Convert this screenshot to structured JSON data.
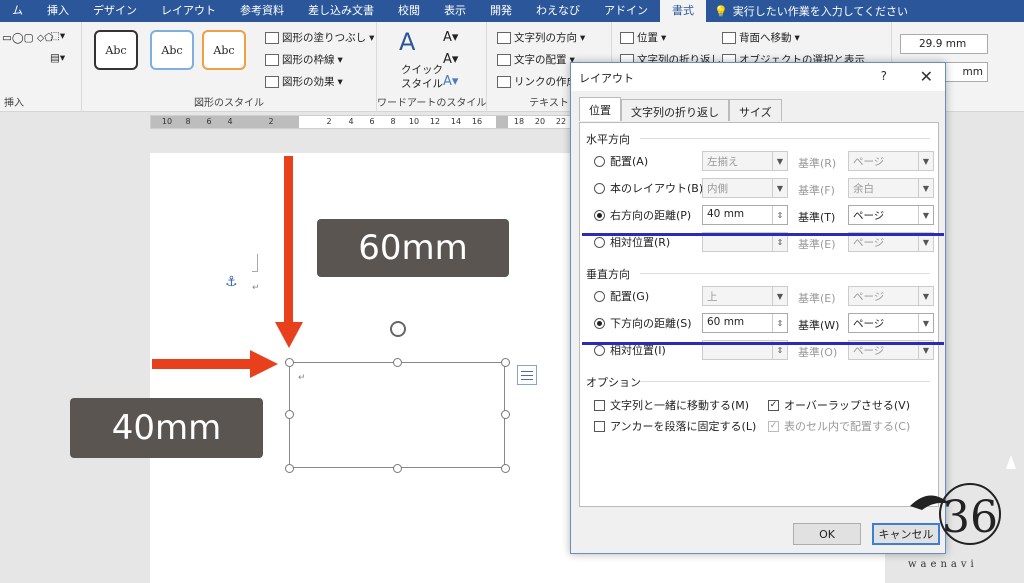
{
  "tabs": [
    "ム",
    "挿入",
    "デザイン",
    "レイアウト",
    "参考資料",
    "差し込み文書",
    "校閲",
    "表示",
    "開発",
    "わえなび",
    "アドイン",
    "書式"
  ],
  "tell_me": "実行したい作業を入力してください",
  "ribbon": {
    "insert_group_label": "挿入",
    "shape_styles_label": "図形のスタイル",
    "style_sample": "Abc",
    "fill": "図形の塗りつぶし",
    "outline": "図形の枠線",
    "effect": "図形の効果",
    "quick_style": "クイック",
    "quick_style2": "スタイル",
    "wordart_label": "ワードアートのスタイル",
    "text_dir": "文字列の方向",
    "text_align": "文字の配置",
    "link": "リンクの作成",
    "text_label": "テキスト",
    "position": "位置",
    "wrap": "文字列の折り返し",
    "bring_forward": "背面へ移動",
    "selection": "オブジェクトの選択と表示",
    "height": "29.9 mm",
    "width": "mm"
  },
  "ruler_numbers": [
    "10",
    "8",
    "6",
    "4",
    "2",
    "",
    "2",
    "4",
    "6",
    "8",
    "10",
    "12",
    "14",
    "16",
    "18",
    "20",
    "22"
  ],
  "document": {
    "label_top": "60mm",
    "label_left": "40mm"
  },
  "dialog": {
    "title": "レイアウト",
    "help": "?",
    "close": "✕",
    "tabs": [
      "位置",
      "文字列の折り返し",
      "サイズ"
    ],
    "horizontal": {
      "heading": "水平方向",
      "rows": [
        {
          "label": "配置(A)",
          "value": "左揃え",
          "base_label": "基準(R)",
          "base": "ページ",
          "selected": false,
          "enabled": false
        },
        {
          "label": "本のレイアウト(B)",
          "value": "内側",
          "base_label": "基準(F)",
          "base": "余白",
          "selected": false,
          "enabled": false
        },
        {
          "label": "右方向の距離(P)",
          "value": "40 mm",
          "base_label": "基準(T)",
          "base": "ページ",
          "selected": true,
          "enabled": true
        },
        {
          "label": "相対位置(R)",
          "value": "",
          "base_label": "基準(E)",
          "base": "ページ",
          "selected": false,
          "enabled": false
        }
      ]
    },
    "vertical": {
      "heading": "垂直方向",
      "rows": [
        {
          "label": "配置(G)",
          "value": "上",
          "base_label": "基準(E)",
          "base": "ページ",
          "selected": false,
          "enabled": false
        },
        {
          "label": "下方向の距離(S)",
          "value": "60 mm",
          "base_label": "基準(W)",
          "base": "ページ",
          "selected": true,
          "enabled": true
        },
        {
          "label": "相対位置(I)",
          "value": "",
          "base_label": "基準(O)",
          "base": "ページ",
          "selected": false,
          "enabled": false
        }
      ]
    },
    "options": {
      "heading": "オプション",
      "move_with_text": "文字列と一緒に移動する(M)",
      "lock_anchor": "アンカーを段落に固定する(L)",
      "allow_overlap": "オーバーラップさせる(V)",
      "in_table": "表のセル内で配置する(C)"
    },
    "ok": "OK",
    "cancel": "キャンセル"
  },
  "watermark": "waenavi",
  "colors": {
    "arrow": "#e8401c",
    "tab_bar": "#2b579a",
    "highlight": "#2b2bb8"
  }
}
